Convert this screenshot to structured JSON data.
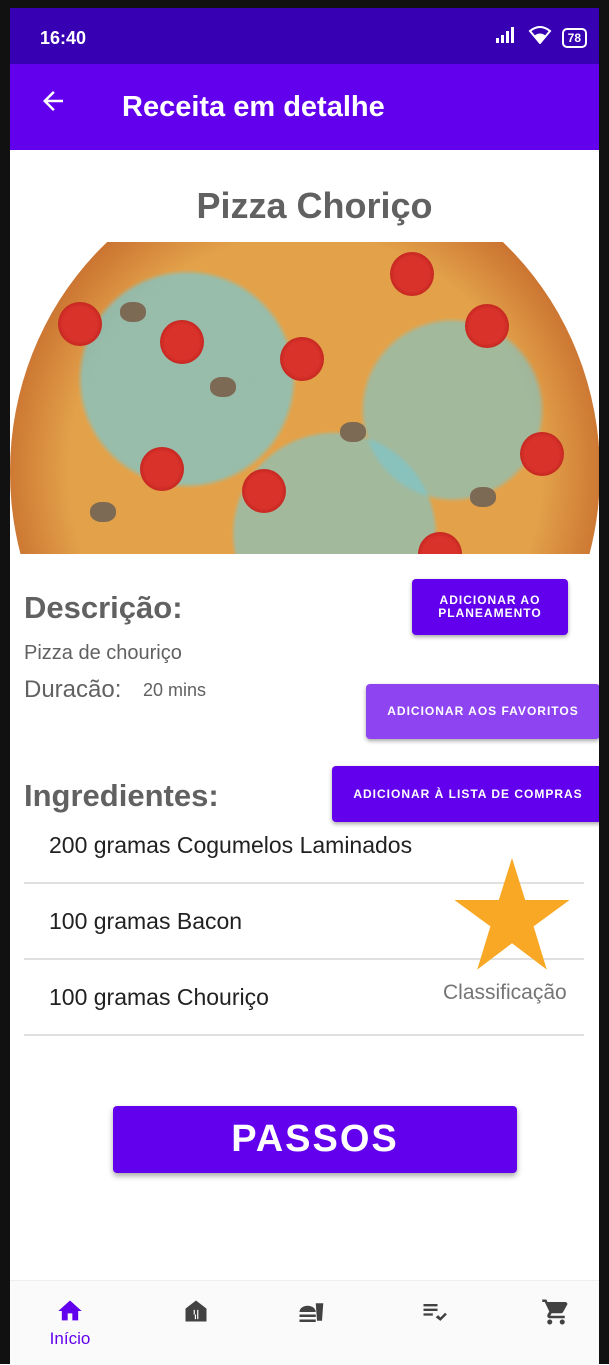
{
  "status_bar": {
    "time": "16:40",
    "battery": "78"
  },
  "app_bar": {
    "title": "Receita em detalhe",
    "back_icon": "arrow-back-icon"
  },
  "recipe": {
    "name": "Pizza Choriço",
    "description_heading": "Descrição:",
    "description": "Pizza de chouriço",
    "duration_label": "Duracão:",
    "duration_value": "20 mins",
    "ingredients_heading": "Ingredientes:",
    "ingredients": [
      "200 gramas Cogumelos Laminados",
      "100 gramas Bacon",
      "100 gramas Chouriço"
    ],
    "rating_label": "Classificação"
  },
  "buttons": {
    "add_to_plan": "ADICIONAR AO PLANEAMENTO",
    "add_to_favorites": "ADICIONAR AOS FAVORITOS",
    "add_to_shopping_list": "ADICIONAR À LISTA DE COMPRAS",
    "steps": "PASSOS"
  },
  "bottom_nav": [
    {
      "label": "Início",
      "icon": "home-icon",
      "active": true
    },
    {
      "label": "",
      "icon": "restaurant-icon",
      "active": false
    },
    {
      "label": "",
      "icon": "fastfood-icon",
      "active": false
    },
    {
      "label": "",
      "icon": "playlist-check-icon",
      "active": false
    },
    {
      "label": "",
      "icon": "cart-icon",
      "active": false
    }
  ],
  "colors": {
    "primary": "#6200ee",
    "primary_dark": "#3700b3",
    "accent_star": "#f9a825"
  }
}
